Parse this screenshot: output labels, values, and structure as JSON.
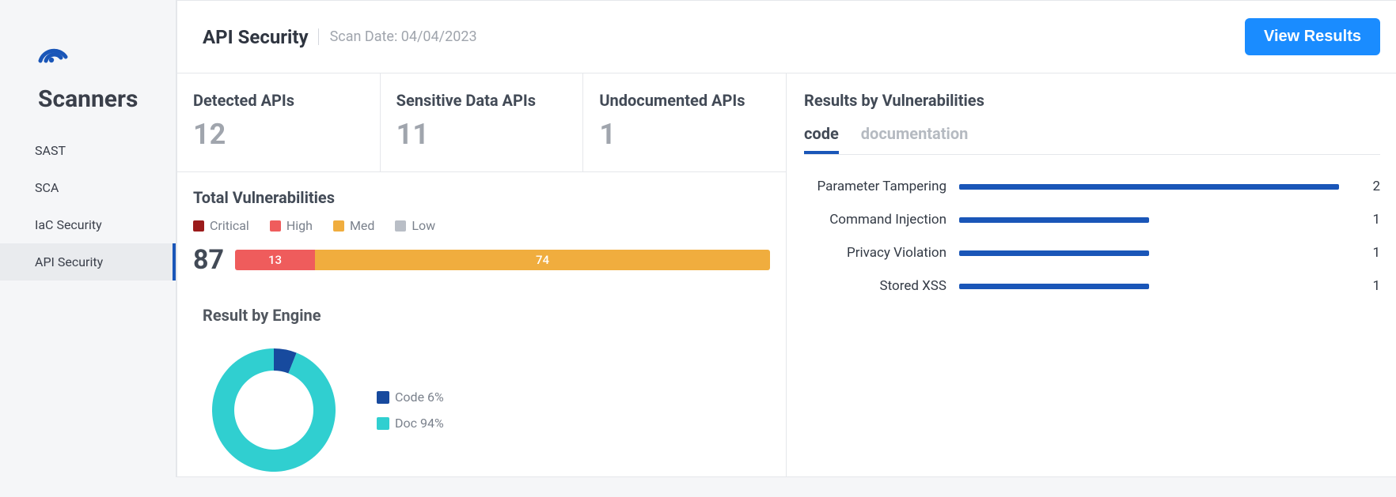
{
  "sidebar": {
    "title": "Scanners",
    "items": [
      {
        "label": "SAST"
      },
      {
        "label": "SCA"
      },
      {
        "label": "IaC Security"
      },
      {
        "label": "API Security"
      }
    ],
    "active_index": 3
  },
  "header": {
    "title": "API Security",
    "scan_date_label": "Scan Date: 04/04/2023",
    "view_results_label": "View Results"
  },
  "stats": [
    {
      "label": "Detected APIs",
      "value": "12"
    },
    {
      "label": "Sensitive Data APIs",
      "value": "11"
    },
    {
      "label": "Undocumented APIs",
      "value": "1"
    }
  ],
  "total_vuln": {
    "title": "Total Vulnerabilities",
    "legend": {
      "critical": "Critical",
      "high": "High",
      "med": "Med",
      "low": "Low"
    },
    "total": "87",
    "segments": [
      {
        "severity": "high",
        "value": 13
      },
      {
        "severity": "med",
        "value": 74
      }
    ]
  },
  "engine": {
    "title": "Result by Engine",
    "legend": {
      "code": "Code 6%",
      "doc": "Doc 94%"
    }
  },
  "results_panel": {
    "title": "Results by Vulnerabilities",
    "tabs": {
      "code": "code",
      "documentation": "documentation",
      "active": "code"
    },
    "rows": [
      {
        "name": "Parameter Tampering",
        "count": 2
      },
      {
        "name": "Command Injection",
        "count": 1
      },
      {
        "name": "Privacy Violation",
        "count": 1
      },
      {
        "name": "Stored XSS",
        "count": 1
      }
    ]
  },
  "chart_data": [
    {
      "type": "bar",
      "orientation": "horizontal",
      "stacked": true,
      "title": "Total Vulnerabilities",
      "categories": [
        "Total"
      ],
      "series": [
        {
          "name": "High",
          "values": [
            13
          ],
          "color": "#ef5c5c"
        },
        {
          "name": "Med",
          "values": [
            74
          ],
          "color": "#f0ad3e"
        }
      ],
      "total": 87
    },
    {
      "type": "pie",
      "variant": "donut",
      "title": "Result by Engine",
      "categories": [
        "Code",
        "Doc"
      ],
      "values": [
        6,
        94
      ],
      "colors": [
        "#174a9e",
        "#30cfd0"
      ]
    },
    {
      "type": "bar",
      "orientation": "horizontal",
      "title": "Results by Vulnerabilities — code",
      "categories": [
        "Parameter Tampering",
        "Command Injection",
        "Privacy Violation",
        "Stored XSS"
      ],
      "values": [
        2,
        1,
        1,
        1
      ],
      "color": "#1a56b8",
      "xlim": [
        0,
        2
      ]
    }
  ]
}
